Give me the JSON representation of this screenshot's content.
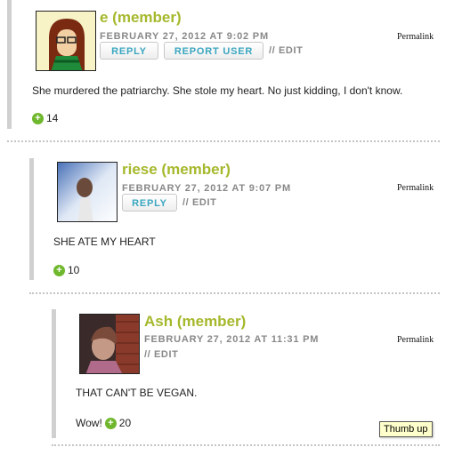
{
  "comments": [
    {
      "author": "e (member)",
      "date": "FEBRUARY 27, 2012 AT 9:02 PM",
      "permalink": "Permalink",
      "reply_label": "REPLY",
      "report_label": "REPORT USER",
      "edit_label": "// EDIT",
      "body": "She murdered the patriarchy. She stole my heart. No just kidding, I don't know.",
      "votes": "14"
    },
    {
      "author": "riese (member)",
      "date": "FEBRUARY 27, 2012 AT 9:07 PM",
      "permalink": "Permalink",
      "reply_label": "REPLY",
      "edit_label": "// EDIT",
      "body": "SHE ATE MY HEART",
      "votes": "10"
    },
    {
      "author": "Ash (member)",
      "date": "FEBRUARY 27, 2012 AT 11:31 PM",
      "permalink": "Permalink",
      "edit_label": "// EDIT",
      "body": "THAT CAN'T BE VEGAN.",
      "vote_prefix": "Wow!",
      "votes": "20"
    }
  ],
  "tooltip": "Thumb up",
  "colors": {
    "author": "#a6b82c",
    "button_text": "#3aa6c0",
    "vote_icon": "#6fb72d",
    "meta": "#888888"
  },
  "icons": {
    "vote": "plus-circle-icon"
  }
}
